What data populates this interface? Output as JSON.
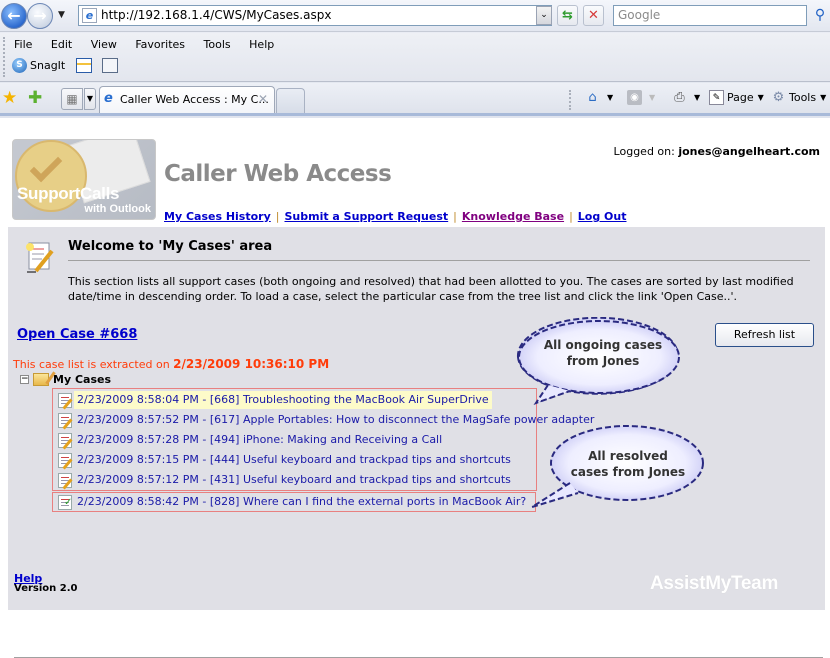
{
  "browser": {
    "url": "http://192.168.1.4/CWS/MyCases.aspx",
    "search_placeholder": "Google",
    "menu": [
      "File",
      "Edit",
      "View",
      "Favorites",
      "Tools",
      "Help"
    ],
    "toolbar_snagit": "SnagIt",
    "tab_title": "Caller Web Access : My C...",
    "commands": {
      "page": "Page",
      "tools": "Tools"
    }
  },
  "header": {
    "logo_line1": "SupportCalls",
    "logo_line2": "with Outlook",
    "app_title": "Caller Web Access",
    "logged_on_label": "Logged on:",
    "logged_on_user": "jones@angelheart.com",
    "nav": [
      {
        "label": "My Cases History"
      },
      {
        "label": "Submit a Support Request"
      },
      {
        "label": "Knowledge Base"
      },
      {
        "label": "Log Out"
      }
    ],
    "nav_separator": "|"
  },
  "welcome": {
    "title": "Welcome to 'My Cases' area",
    "description": "This section lists all support cases (both ongoing and resolved) that had been allotted to you. The cases are sorted by last modified date/time in descending order. To load a case, select the particular case from the tree list and click the link 'Open Case..'."
  },
  "cases": {
    "open_case_link": "Open Case #668",
    "refresh_label": "Refresh list",
    "extracted_prefix": "This case list is extracted on",
    "extracted_time": "2/23/2009 10:36:10 PM",
    "tree_root": "My Cases",
    "ongoing": [
      {
        "text": "2/23/2009 8:58:04 PM - [668] Troubleshooting the MacBook Air SuperDrive",
        "selected": true
      },
      {
        "text": "2/23/2009 8:57:52 PM - [617] Apple Portables: How to disconnect the MagSafe power adapter"
      },
      {
        "text": "2/23/2009 8:57:28 PM - [494] iPhone: Making and Receiving a Call"
      },
      {
        "text": "2/23/2009 8:57:15 PM - [444] Useful keyboard and trackpad tips and shortcuts"
      },
      {
        "text": "2/23/2009 8:57:12 PM - [431] Useful keyboard and trackpad tips and shortcuts"
      }
    ],
    "resolved": [
      {
        "text": "2/23/2009 8:58:42 PM - [828] Where can I find the external ports in MacBook Air?"
      }
    ]
  },
  "callouts": {
    "ongoing_line1": "All ongoing cases",
    "ongoing_line2": "from Jones",
    "resolved_line1": "All resolved",
    "resolved_line2": "cases from Jones"
  },
  "footer": {
    "help_label": "Help",
    "version": "Version 2.0",
    "brand": "AssistMyTeam"
  },
  "colors": {
    "link": "#0000cc",
    "visited_link": "#800080",
    "extracted_text": "#ff3c0a",
    "panel_bg": "#e0e0e6",
    "case_group_border": "#e88080",
    "bubble_border": "#2a2a80"
  }
}
